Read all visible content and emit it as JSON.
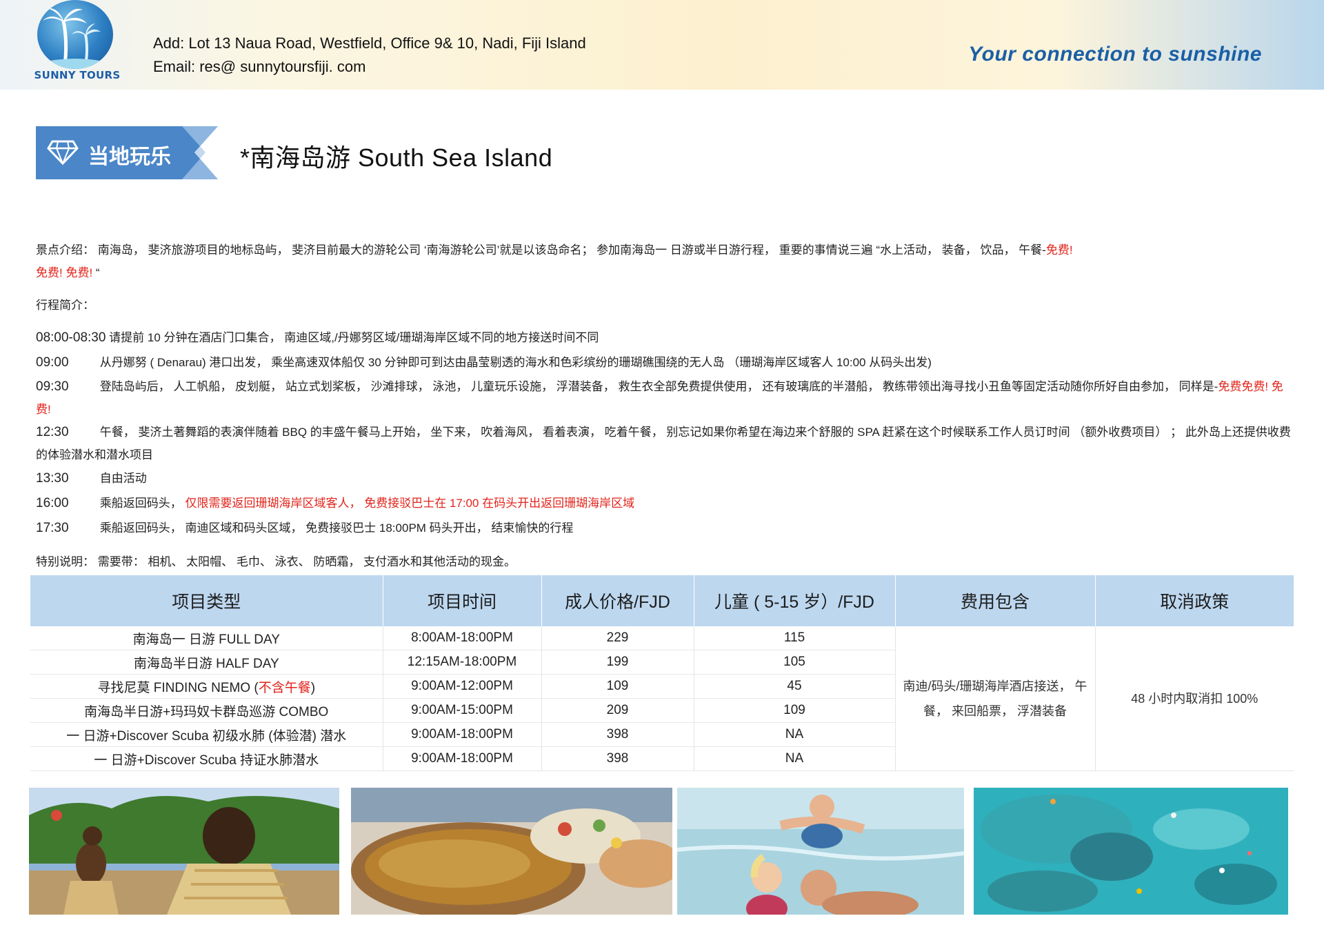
{
  "header": {
    "logo_text": "SUNNY TOURS",
    "address": "Add: Lot 13 Naua Road, Westfield, Office 9& 10, Nadi, Fiji Island",
    "email": "Email:   res@ sunnytoursfiji. com",
    "tagline": "Your connection to sunshine"
  },
  "badge": {
    "label": "当地玩乐",
    "icon": "diamond-icon"
  },
  "title": "*南海岛游  South Sea Island",
  "intro": {
    "text": "景点介绍：  南海岛，  斐济旅游项目的地标岛屿，  斐济目前最大的游轮公司 ‘南海游轮公司’就是以该岛命名；  参加南海岛一 日游或半日游行程，  重要的事情说三遍 “水上活动，  装备，  饮品，  午餐-",
    "free1": "免费!",
    "line2_free": "免费!   免费!",
    "end_quote": "  “"
  },
  "itinerary_label": "行程简介：",
  "itinerary": [
    {
      "time": "08:00-08:30",
      "text": "请提前 10 分钟在酒店门口集合，   南迪区域,/丹娜努区域/珊瑚海岸区域不同的地方接送时间不同"
    },
    {
      "time": "09:00",
      "text": "从丹娜努  ( Denarau)  港口出发，   乘坐高速双体船仅 30 分钟即可到达由晶莹剔透的海水和色彩缤纷的珊瑚礁围绕的无人岛 （珊瑚海岸区域客人 10:00 从码头出发)"
    },
    {
      "time": "09:30",
      "text": "登陆岛屿后，  人工帆船，  皮划艇，  站立式划桨板，  沙滩排球，  泳池，  儿童玩乐设施，  浮潜装备，  救生衣全部免费提供使用，   还有玻璃底的半潜船，   教练带领出海寻找小丑鱼等固定活动随你所好自由参加，  同样是-",
      "red": "免费免费!   免费!"
    },
    {
      "time": "12:30",
      "text": "午餐，  斐济土著舞蹈的表演伴随着 BBQ 的丰盛午餐马上开始，   坐下来，   吹着海风，   看着表演，   吃着午餐，   别忘记如果你希望在海边来个舒服的 SPA 赶紧在这个时候联系工作人员订时间 （额外收费项目）  ；  此外岛上还提供收费的体验潜水和潜水项目"
    },
    {
      "time": "13:30",
      "text": "自由活动"
    },
    {
      "time": "16:00",
      "text": "乘船返回码头，  ",
      "red": "仅限需要返回珊瑚海岸区域客人，   免费接驳巴士在 17:00 在码头开出返回珊瑚海岸区域"
    },
    {
      "time": "17:30",
      "text": "乘船返回码头，   南迪区域和码头区域，   免费接驳巴士 18:00PM 码头开出，   结束愉快的行程"
    }
  ],
  "special_note": "特别说明：  需要带：  相机、  太阳帽、  毛巾、  泳衣、  防晒霜，  支付酒水和其他活动的现金。",
  "table": {
    "headers": [
      "项目类型",
      "项目时间",
      "成人价格/FJD",
      "儿童 ( 5-15 岁）/FJD",
      "费用包含",
      "取消政策"
    ],
    "rows": [
      {
        "name": "南海岛一 日游   FULL DAY",
        "time": "8:00AM-18:00PM",
        "adult": "229",
        "child": "115"
      },
      {
        "name": "南海岛半日游   HALF DAY",
        "time": "12:15AM-18:00PM",
        "adult": "199",
        "child": "105"
      },
      {
        "name": "寻找尼莫  FINDING NEMO (",
        "name_red": "不含午餐",
        "name_end": ")",
        "time": "9:00AM-12:00PM",
        "adult": "109",
        "child": "45"
      },
      {
        "name": "南海岛半日游+玛玛奴卡群岛巡游   COMBO",
        "time": "9:00AM-15:00PM",
        "adult": "209",
        "child": "109"
      },
      {
        "name": "一 日游+Discover  Scuba 初级水肺  (体验潜)  潜水",
        "time": "9:00AM-18:00PM",
        "adult": "398",
        "child": "NA"
      },
      {
        "name": "一 日游+Discover  Scuba 持证水肺潜水",
        "time": "9:00AM-18:00PM",
        "adult": "398",
        "child": "NA"
      }
    ],
    "includes": "南迪/码头/珊瑚海岸酒店接送，  午餐，  来回船票，  浮潜装备",
    "cancellation": "48 小时内取消扣 100%"
  },
  "photos": [
    "fijian-dancers-photo",
    "bbq-buffet-photo",
    "kids-in-water-photo",
    "aerial-reef-photo"
  ]
}
